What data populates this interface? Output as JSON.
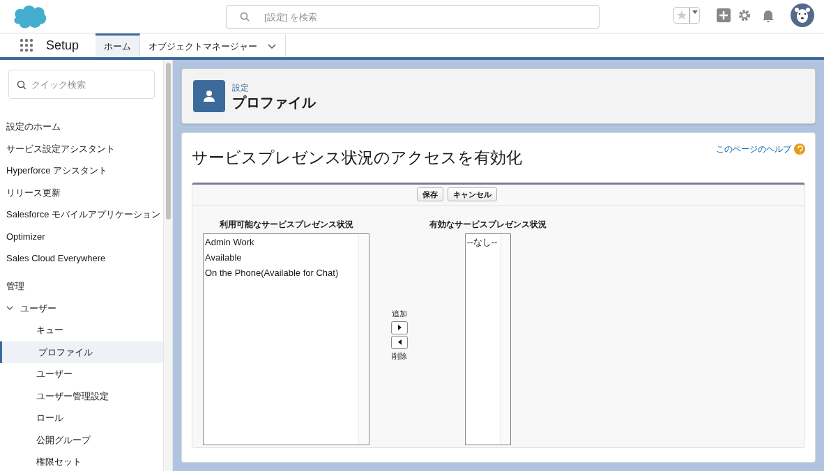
{
  "header": {
    "search": {
      "placeholder": "[設定] を検索"
    }
  },
  "nav": {
    "app_name": "Setup",
    "tabs": [
      {
        "label": "ホーム",
        "selected": true,
        "menu": false
      },
      {
        "label": "オブジェクトマネージャー",
        "selected": false,
        "menu": true
      }
    ]
  },
  "sidebar": {
    "search": {
      "placeholder": "クイック検索"
    },
    "items": [
      {
        "label": "設定のホーム",
        "selected": false
      },
      {
        "label": "サービス設定アシスタント",
        "selected": false
      },
      {
        "label": "Hyperforce アシスタント",
        "selected": false
      },
      {
        "label": "リリース更新",
        "selected": false
      },
      {
        "label": "Salesforce モバイルアプリケーション",
        "selected": false
      },
      {
        "label": "Optimizer",
        "selected": false
      },
      {
        "label": "Sales Cloud Everywhere",
        "selected": false
      }
    ],
    "section_title": "管理",
    "tree": [
      {
        "label": "ユーザー",
        "expanded": true,
        "children": [
          {
            "label": "キュー",
            "selected": false
          },
          {
            "label": "プロファイル",
            "selected": true
          },
          {
            "label": "ユーザー",
            "selected": false
          },
          {
            "label": "ユーザー管理設定",
            "selected": false
          },
          {
            "label": "ロール",
            "selected": false
          },
          {
            "label": "公開グループ",
            "selected": false
          },
          {
            "label": "権限セット",
            "selected": false
          }
        ]
      }
    ]
  },
  "page_header": {
    "breadcrumb": "設定",
    "title": "プロファイル"
  },
  "content": {
    "title": "サービスプレゼンス状況のアクセスを有効化",
    "help_link": "このページのヘルプ",
    "buttons": [
      "保存",
      "キャンセル"
    ],
    "available": {
      "label": "利用可能なサービスプレゼンス状況",
      "options": [
        "Admin Work",
        "Available",
        "On the Phone(Available for Chat)"
      ]
    },
    "add_label": "追加",
    "remove_label": "削除",
    "enabled": {
      "label": "有効なサービスプレゼンス状況",
      "options": [
        "--なし--"
      ]
    }
  }
}
